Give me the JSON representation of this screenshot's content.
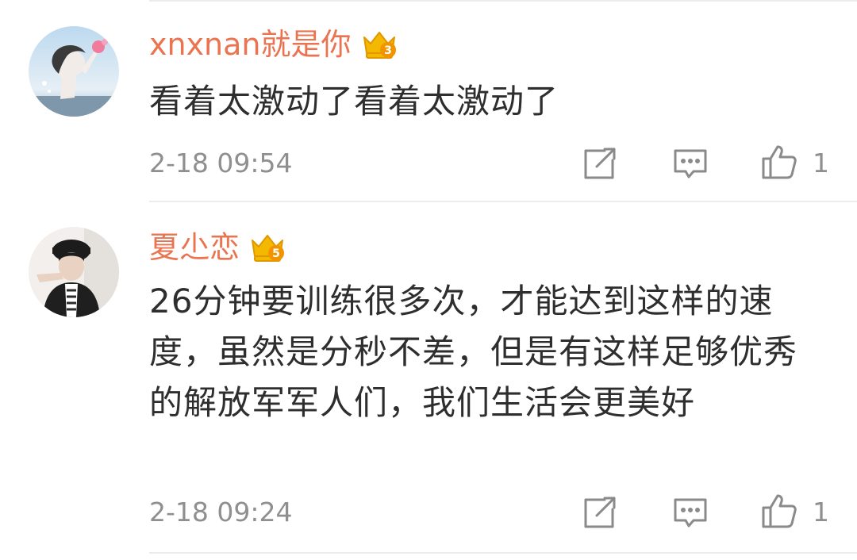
{
  "comments": [
    {
      "user": "xnxnan就是你",
      "badge_icon": "vip-crown-icon",
      "badge_level": "3",
      "text": "看着太激动了看着太激动了",
      "time": "2-18 09:54",
      "actions": {
        "share_icon": "share-icon",
        "comment_icon": "comment-icon",
        "like_icon": "like-icon",
        "like_count": "1"
      }
    },
    {
      "user": "夏尐恋",
      "badge_icon": "vip-crown-icon",
      "badge_level": "5",
      "text": "26分钟要训练很多次，才能达到这样的速度，虽然是分秒不差，但是有这样足够优秀的解放军军人们，我们生活会更美好",
      "time": "2-18 09:24",
      "actions": {
        "share_icon": "share-icon",
        "comment_icon": "comment-icon",
        "like_icon": "like-icon",
        "like_count": "1"
      }
    }
  ],
  "colors": {
    "username": "#eb7350",
    "body_text": "#2e2e2e",
    "meta_text": "#8f8f8f",
    "icon": "#8a8a8a",
    "badge_gold": "#f5b800",
    "divider": "#ececec"
  }
}
